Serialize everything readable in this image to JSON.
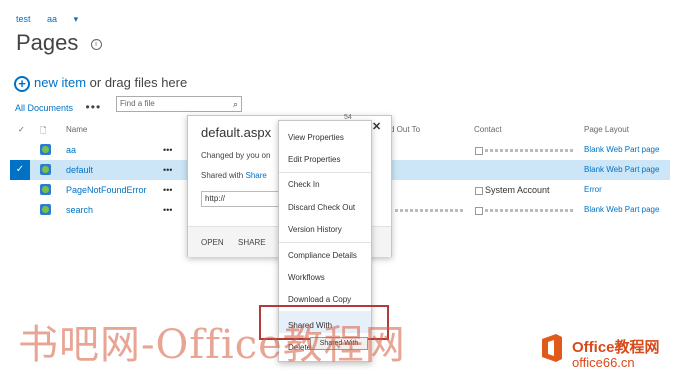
{
  "topnav": {
    "site": "test",
    "user": "aa",
    "caret": "▾"
  },
  "page": {
    "title": "Pages"
  },
  "new_item": {
    "label": "new item",
    "suffix": "or drag files here"
  },
  "views": {
    "current": "All Documents",
    "more": "•••"
  },
  "search": {
    "placeholder": "Find a file",
    "icon": "⌕"
  },
  "columns": {
    "name": "Name",
    "checked_out_to": "d Out To",
    "contact": "Contact",
    "page_layout": "Page Layout"
  },
  "rows": [
    {
      "name": "aa",
      "contact": "",
      "layout": "Blank Web Part page",
      "selected": false,
      "more": "•••"
    },
    {
      "name": "default",
      "contact": "",
      "layout": "Blank Web Part page",
      "selected": true,
      "more": "•••"
    },
    {
      "name": "PageNotFoundError",
      "contact": "System Account",
      "layout": "Error",
      "selected": false,
      "more": "•••"
    },
    {
      "name": "search",
      "contact": "",
      "layout": "Blank Web Part page",
      "selected": false,
      "more": "•••"
    }
  ],
  "callout": {
    "file_name": "default.aspx",
    "changed": "Changed by you on",
    "shared_with": "Shared with",
    "shared_link": "Share",
    "url": "http://",
    "open": "OPEN",
    "share": "SHARE",
    "count": "54"
  },
  "menu": {
    "items": [
      "View Properties",
      "Edit Properties",
      "Check In",
      "Discard Check Out",
      "Version History",
      "Compliance Details",
      "Workflows",
      "Download a Copy",
      "Shared With",
      "Delete"
    ],
    "close": "✕"
  },
  "tooltip": "Shared With",
  "watermark": {
    "text": "书吧网-Office教程网",
    "logo_line1": "Office教程网",
    "logo_line2": "office66.cn"
  },
  "colors": {
    "accent": "#0072c6",
    "selected_row": "#cde6f7",
    "highlight": "#b23a3a"
  }
}
